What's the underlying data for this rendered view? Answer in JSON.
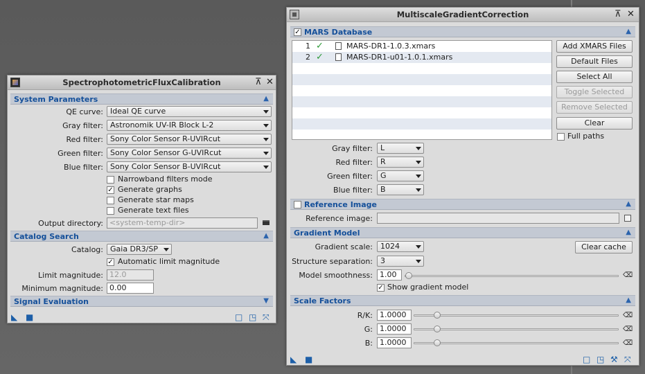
{
  "spfc": {
    "title": "SpectrophotometricFluxCalibration",
    "sec_system": "System Parameters",
    "qe_label": "QE curve:",
    "qe_value": "Ideal QE curve",
    "gray_label": "Gray filter:",
    "gray_value": "Astronomik UV-IR Block L-2",
    "red_label": "Red filter:",
    "red_value": "Sony Color Sensor R-UVIRcut",
    "green_label": "Green filter:",
    "green_value": "Sony Color Sensor G-UVIRcut",
    "blue_label": "Blue filter:",
    "blue_value": "Sony Color Sensor B-UVIRcut",
    "narrowband": "Narrowband filters mode",
    "narrowband_checked": false,
    "gen_graphs": "Generate graphs",
    "gen_graphs_checked": true,
    "gen_star": "Generate star maps",
    "gen_star_checked": false,
    "gen_text": "Generate text files",
    "gen_text_checked": false,
    "outdir_label": "Output directory:",
    "outdir_placeholder": "<system-temp-dir>",
    "sec_catalog": "Catalog Search",
    "catalog_label": "Catalog:",
    "catalog_value": "Gaia DR3/SP",
    "auto_limit": "Automatic limit magnitude",
    "auto_limit_checked": true,
    "limit_label": "Limit magnitude:",
    "limit_value": "12.0",
    "minmag_label": "Minimum magnitude:",
    "minmag_value": "0.00",
    "sec_signal": "Signal Evaluation"
  },
  "mgc": {
    "title": "MultiscaleGradientCorrection",
    "sec_mars": "MARS Database",
    "mars_checked": true,
    "files": [
      {
        "num": "1",
        "name": "MARS-DR1-1.0.3.xmars"
      },
      {
        "num": "2",
        "name": "MARS-DR1-u01-1.0.1.xmars"
      }
    ],
    "btn_add": "Add XMARS Files",
    "btn_default": "Default Files",
    "btn_selall": "Select All",
    "btn_toggle": "Toggle Selected",
    "btn_remove": "Remove Selected",
    "btn_clear": "Clear",
    "fullpaths": "Full paths",
    "fullpaths_checked": false,
    "gray_label": "Gray filter:",
    "gray_value": "L",
    "red_label": "Red filter:",
    "red_value": "R",
    "green_label": "Green filter:",
    "green_value": "G",
    "blue_label": "Blue filter:",
    "blue_value": "B",
    "sec_ref": "Reference Image",
    "ref_checked": false,
    "ref_label": "Reference image:",
    "ref_value": "",
    "sec_grad": "Gradient Model",
    "scale_label": "Gradient scale:",
    "scale_value": "1024",
    "clear_cache": "Clear cache",
    "struct_label": "Structure separation:",
    "struct_value": "3",
    "smooth_label": "Model smoothness:",
    "smooth_value": "1.00",
    "smooth_level": 0.0,
    "show_grad": "Show gradient model",
    "show_grad_checked": true,
    "sec_scale": "Scale Factors",
    "rk_label": "R/K:",
    "rk_value": "1.0000",
    "rk_level": 0.1,
    "g_label": "G:",
    "g_value": "1.0000",
    "g_level": 0.1,
    "b_label": "B:",
    "b_value": "1.0000",
    "b_level": 0.1
  }
}
